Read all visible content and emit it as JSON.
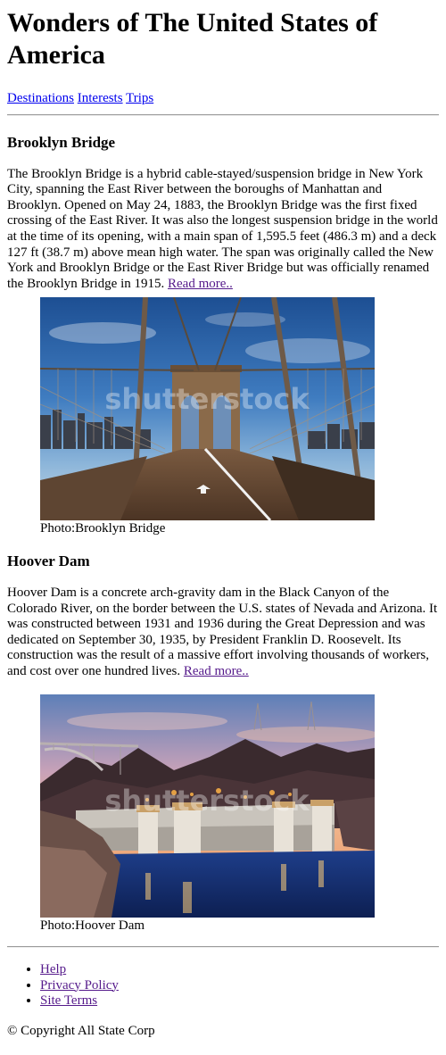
{
  "page": {
    "title": "Wonders of The United States of America"
  },
  "nav": {
    "items": [
      {
        "label": "Destinations"
      },
      {
        "label": "Interests"
      },
      {
        "label": "Trips"
      }
    ]
  },
  "articles": [
    {
      "heading": "Brooklyn Bridge",
      "body": "The Brooklyn Bridge is a hybrid cable-stayed/suspension bridge in New York City, spanning the East River between the boroughs of Manhattan and Brooklyn. Opened on May 24, 1883, the Brooklyn Bridge was the first fixed crossing of the East River. It was also the longest suspension bridge in the world at the time of its opening, with a main span of 1,595.5 feet (486.3 m) and a deck 127 ft (38.7 m) above mean high water. The span was originally called the New York and Brooklyn Bridge or the East River Bridge but was officially renamed the Brooklyn Bridge in 1915.",
      "read_more": "Read more..",
      "watermark": "shutterstock",
      "caption": "Photo:Brooklyn Bridge"
    },
    {
      "heading": "Hoover Dam",
      "body": "Hoover Dam is a concrete arch-gravity dam in the Black Canyon of the Colorado River, on the border between the U.S. states of Nevada and Arizona. It was constructed between 1931 and 1936 during the Great Depression and was dedicated on September 30, 1935, by President Franklin D. Roosevelt. Its construction was the result of a massive effort involving thousands of workers, and cost over one hundred lives.",
      "read_more": "Read more..",
      "watermark": "shutterstock",
      "caption": "Photo:Hoover Dam"
    }
  ],
  "footer": {
    "links": [
      {
        "label": "Help"
      },
      {
        "label": "Privacy Policy"
      },
      {
        "label": "Site Terms"
      }
    ],
    "copyright": "© Copyright All State Corp"
  },
  "colors": {
    "link": "#0000ee",
    "visited_link": "#551a8b",
    "divider": "#9a9a9a"
  }
}
